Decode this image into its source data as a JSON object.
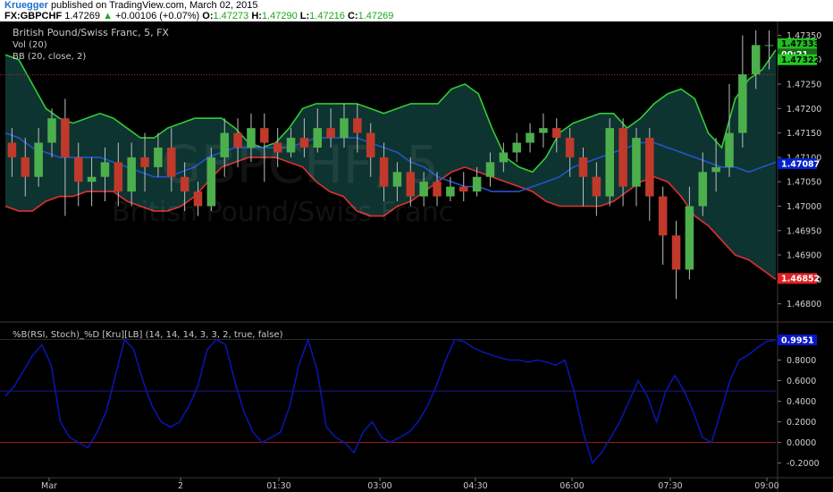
{
  "header": {
    "author": "Kruegger",
    "published": "published on TradingView.com, March 02, 2015",
    "symbol": "FX:GBPCHF",
    "last": "1.47269",
    "change": "+0.00106 (+0.07%)",
    "o_label": "O:",
    "o": "1.47273",
    "h_label": "H:",
    "h": "1.47290",
    "l_label": "L:",
    "l": "1.47216",
    "c_label": "C:",
    "c": "1.47269"
  },
  "main": {
    "title": "British Pound/Swiss Franc, 5, FX",
    "vol": "Vol (20)",
    "bb": "BB (20, close, 2)",
    "watermark_symbol": "GBPCHF, 5",
    "watermark_name": "British Pound/Swiss Franc"
  },
  "indicator": {
    "title": "%B(RSI, Stoch)_%D [Kru][LB] (14, 14, 14, 3, 3, 2, true, false)"
  },
  "colors": {
    "background": "#000000",
    "bull": "#4caf4c",
    "bear": "#c0392b",
    "upper_band": "#33cc33",
    "lower_band": "#e03030",
    "basis": "#2255cc",
    "band_fill": "#0f3a36",
    "osc": "#0a16a8",
    "price_tag": "#22bb22",
    "upper_tag": "#22cc22",
    "basis_tag": "#0022cc",
    "lower_tag": "#e02020"
  },
  "chart_data": [
    {
      "type": "candlestick",
      "y_ticks": [
        "1.47350",
        "1.47300",
        "1.47250",
        "1.47200",
        "1.47150",
        "1.47100",
        "1.47050",
        "1.47000",
        "1.46950",
        "1.46900",
        "1.46850",
        "1.46800"
      ],
      "ylim": [
        1.4677,
        1.4736
      ],
      "x_ticks": [
        "Mar",
        "2",
        "01:30",
        "03:00",
        "04:30",
        "06:00",
        "07:30",
        "09:00"
      ],
      "price_tags": {
        "last": "1.47333",
        "countdown": "00:21",
        "upper": "1.47322",
        "basis": "1.47087",
        "lower": "1.46852"
      },
      "upper_band": [
        1.4731,
        1.473,
        1.4725,
        1.472,
        1.4718,
        1.4717,
        1.4718,
        1.4719,
        1.4718,
        1.4716,
        1.4714,
        1.4714,
        1.4716,
        1.4717,
        1.4718,
        1.4718,
        1.4718,
        1.4716,
        1.4713,
        1.4712,
        1.4713,
        1.4716,
        1.472,
        1.4721,
        1.4721,
        1.4721,
        1.4721,
        1.472,
        1.4719,
        1.472,
        1.4721,
        1.4721,
        1.4721,
        1.4724,
        1.4725,
        1.4723,
        1.4716,
        1.471,
        1.4708,
        1.4707,
        1.471,
        1.4715,
        1.4717,
        1.4718,
        1.4719,
        1.4719,
        1.4716,
        1.4718,
        1.4721,
        1.4723,
        1.4724,
        1.4722,
        1.4715,
        1.4712,
        1.4722,
        1.4726,
        1.4728,
        1.4732
      ],
      "basis": [
        1.4715,
        1.4714,
        1.4712,
        1.4711,
        1.471,
        1.471,
        1.471,
        1.471,
        1.4709,
        1.4708,
        1.4707,
        1.4706,
        1.4706,
        1.4707,
        1.4708,
        1.471,
        1.4711,
        1.4712,
        1.4712,
        1.4712,
        1.4712,
        1.4712,
        1.4713,
        1.4714,
        1.4714,
        1.4714,
        1.4714,
        1.4713,
        1.4712,
        1.4711,
        1.4709,
        1.4708,
        1.4706,
        1.4705,
        1.4704,
        1.4704,
        1.4703,
        1.4703,
        1.4703,
        1.4704,
        1.4705,
        1.4706,
        1.4708,
        1.4709,
        1.471,
        1.4711,
        1.4712,
        1.4713,
        1.4713,
        1.4712,
        1.4711,
        1.471,
        1.4709,
        1.4708,
        1.4708,
        1.4707,
        1.4708,
        1.4709
      ],
      "lower_band": [
        1.47,
        1.4699,
        1.4699,
        1.4701,
        1.4702,
        1.4702,
        1.4703,
        1.4703,
        1.4703,
        1.4701,
        1.47,
        1.4699,
        1.4699,
        1.47,
        1.4702,
        1.4705,
        1.4708,
        1.4709,
        1.471,
        1.471,
        1.471,
        1.4709,
        1.4708,
        1.4705,
        1.4703,
        1.4702,
        1.4699,
        1.4698,
        1.4698,
        1.47,
        1.4701,
        1.4703,
        1.4705,
        1.4707,
        1.4708,
        1.4707,
        1.4706,
        1.4705,
        1.4704,
        1.4703,
        1.4701,
        1.47,
        1.47,
        1.47,
        1.47,
        1.4701,
        1.4703,
        1.4705,
        1.4706,
        1.4705,
        1.4702,
        1.4698,
        1.4696,
        1.4693,
        1.469,
        1.4689,
        1.4687,
        1.4685
      ],
      "candles": [
        [
          1.4713,
          1.471,
          1.4716,
          1.4706
        ],
        [
          1.471,
          1.4706,
          1.4714,
          1.4702
        ],
        [
          1.4706,
          1.4713,
          1.4716,
          1.4704
        ],
        [
          1.4713,
          1.4718,
          1.472,
          1.471
        ],
        [
          1.4718,
          1.471,
          1.4722,
          1.4698
        ],
        [
          1.471,
          1.4705,
          1.4713,
          1.47
        ],
        [
          1.4705,
          1.4706,
          1.471,
          1.47
        ],
        [
          1.4706,
          1.4709,
          1.4712,
          1.4701
        ],
        [
          1.4709,
          1.4703,
          1.4713,
          1.47
        ],
        [
          1.4703,
          1.471,
          1.4713,
          1.47
        ],
        [
          1.471,
          1.4708,
          1.4715,
          1.4703
        ],
        [
          1.4708,
          1.4712,
          1.4715,
          1.4706
        ],
        [
          1.4712,
          1.4706,
          1.4716,
          1.4703
        ],
        [
          1.4706,
          1.4703,
          1.4709,
          1.4699
        ],
        [
          1.4703,
          1.47,
          1.4705,
          1.4698
        ],
        [
          1.47,
          1.471,
          1.4712,
          1.4699
        ],
        [
          1.471,
          1.4715,
          1.4718,
          1.4706
        ],
        [
          1.4715,
          1.4712,
          1.4718,
          1.4708
        ],
        [
          1.4712,
          1.4716,
          1.4719,
          1.4709
        ],
        [
          1.4716,
          1.4713,
          1.4719,
          1.4705
        ],
        [
          1.4713,
          1.4711,
          1.4716,
          1.4708
        ],
        [
          1.4711,
          1.4714,
          1.4716,
          1.471
        ],
        [
          1.4714,
          1.4712,
          1.4718,
          1.471
        ],
        [
          1.4712,
          1.4716,
          1.472,
          1.4711
        ],
        [
          1.4716,
          1.4714,
          1.472,
          1.4712
        ],
        [
          1.4714,
          1.4718,
          1.4721,
          1.4712
        ],
        [
          1.4718,
          1.4715,
          1.4721,
          1.4711
        ],
        [
          1.4715,
          1.471,
          1.4717,
          1.4706
        ],
        [
          1.471,
          1.4704,
          1.4713,
          1.4701
        ],
        [
          1.4704,
          1.4707,
          1.4709,
          1.4701
        ],
        [
          1.4707,
          1.4702,
          1.471,
          1.47
        ],
        [
          1.4702,
          1.4705,
          1.4707,
          1.47
        ],
        [
          1.4705,
          1.4702,
          1.4707,
          1.47
        ],
        [
          1.4702,
          1.4704,
          1.4706,
          1.4701
        ],
        [
          1.4704,
          1.4703,
          1.4707,
          1.4701
        ],
        [
          1.4703,
          1.4706,
          1.4708,
          1.4702
        ],
        [
          1.4706,
          1.4709,
          1.4711,
          1.4704
        ],
        [
          1.4709,
          1.4711,
          1.4713,
          1.4707
        ],
        [
          1.4711,
          1.4713,
          1.4715,
          1.4709
        ],
        [
          1.4713,
          1.4715,
          1.4717,
          1.4711
        ],
        [
          1.4715,
          1.4716,
          1.4719,
          1.4712
        ],
        [
          1.4716,
          1.4714,
          1.4718,
          1.4711
        ],
        [
          1.4714,
          1.471,
          1.4716,
          1.4706
        ],
        [
          1.471,
          1.4706,
          1.4712,
          1.47
        ],
        [
          1.4706,
          1.4702,
          1.4709,
          1.4698
        ],
        [
          1.4702,
          1.4716,
          1.4718,
          1.47
        ],
        [
          1.4716,
          1.4704,
          1.4718,
          1.47
        ],
        [
          1.4704,
          1.4714,
          1.4716,
          1.47
        ],
        [
          1.4714,
          1.4702,
          1.4716,
          1.4697
        ],
        [
          1.4702,
          1.4694,
          1.4704,
          1.4688
        ],
        [
          1.4694,
          1.4687,
          1.4697,
          1.4681
        ],
        [
          1.4687,
          1.47,
          1.4704,
          1.4685
        ],
        [
          1.47,
          1.4707,
          1.4711,
          1.4698
        ],
        [
          1.4707,
          1.4708,
          1.4714,
          1.4703
        ],
        [
          1.4708,
          1.4715,
          1.4725,
          1.4706
        ],
        [
          1.4715,
          1.4727,
          1.4735,
          1.4712
        ],
        [
          1.4727,
          1.4733,
          1.4736,
          1.4724
        ],
        [
          1.4733,
          1.4733,
          1.4736,
          1.4728
        ]
      ]
    },
    {
      "type": "line",
      "series": [
        {
          "values": [
            0.45,
            0.55,
            0.7,
            0.85,
            0.95,
            0.75,
            0.2,
            0.05,
            0.0,
            -0.05,
            0.1,
            0.3,
            0.65,
            1.0,
            0.9,
            0.6,
            0.35,
            0.2,
            0.15,
            0.2,
            0.35,
            0.55,
            0.9,
            1.0,
            0.95,
            0.6,
            0.3,
            0.1,
            0.0,
            0.05,
            0.1,
            0.35,
            0.75,
            1.0,
            0.7,
            0.15,
            0.05,
            0.0,
            -0.1,
            0.1,
            0.2,
            0.05,
            0.0,
            0.05,
            0.1,
            0.2,
            0.35,
            0.55,
            0.8,
            1.0,
            0.98,
            0.92,
            0.88,
            0.85,
            0.82,
            0.8,
            0.8,
            0.78,
            0.8,
            0.78,
            0.75,
            0.8,
            0.5,
            0.1,
            -0.2,
            -0.1,
            0.05,
            0.2,
            0.4,
            0.6,
            0.45,
            0.2,
            0.5,
            0.65,
            0.5,
            0.3,
            0.05,
            0.0,
            0.3,
            0.6,
            0.8,
            0.85,
            0.92,
            0.98,
            0.995
          ]
        }
      ],
      "y_ticks": [
        "0.8000",
        "0.6000",
        "0.4000",
        "0.2000",
        "0.0000",
        "-0.2000"
      ],
      "ylim": [
        -0.29,
        1.1
      ],
      "levels": [
        1.0,
        0.5,
        0.0
      ],
      "last_tag": "0.9951"
    }
  ]
}
